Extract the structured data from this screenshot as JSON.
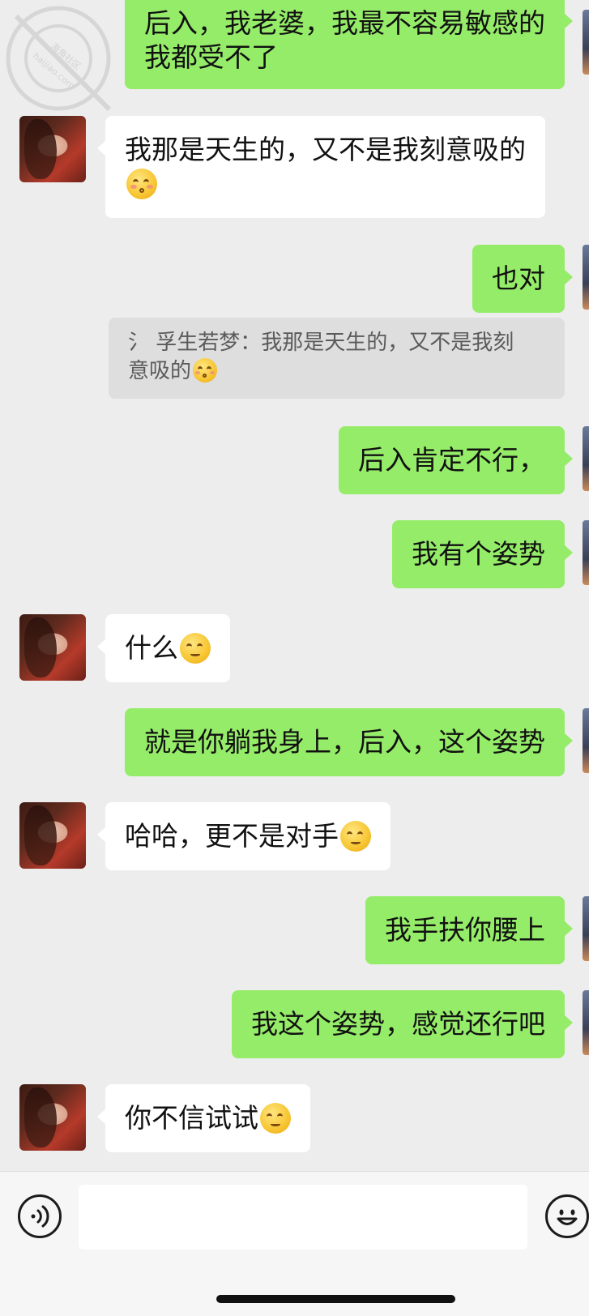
{
  "messages": [
    {
      "side": "out",
      "lines": [
        "后入，我老婆，我最不容易敏感的",
        "我都受不了"
      ]
    },
    {
      "side": "in",
      "lines": [
        "我那是天生的，又不是我刻意吸的"
      ],
      "emoji": "kissing-face"
    },
    {
      "side": "out",
      "text": "也对"
    },
    {
      "side": "out",
      "text": "后入肯定不行，"
    },
    {
      "side": "out",
      "text": "我有个姿势"
    },
    {
      "side": "in",
      "text": "什么",
      "emoji": "smiling-face"
    },
    {
      "side": "out",
      "text": "就是你躺我身上，后入，这个姿势"
    },
    {
      "side": "in",
      "text": "哈哈，更不是对手",
      "emoji": "smiling-face"
    },
    {
      "side": "out",
      "text": "我手扶你腰上"
    },
    {
      "side": "out",
      "text": "我这个姿势，感觉还行吧"
    },
    {
      "side": "in",
      "text": "你不信试试",
      "emoji": "smiling-face"
    }
  ],
  "quote": {
    "author": "孚生若梦",
    "line1": "氵 孚生若梦：我那是天生的，又不是我刻",
    "line2": "意吸的",
    "emoji": "kissing-face"
  },
  "watermark": {
    "text1": "海角社区",
    "text2": "haijiao.com"
  },
  "input_bar": {
    "placeholder": "",
    "voice_icon": "voice-icon",
    "emoji_icon": "emoji-icon"
  },
  "colors": {
    "outgoing": "#95ec69",
    "incoming": "#ffffff",
    "background": "#ededed"
  }
}
